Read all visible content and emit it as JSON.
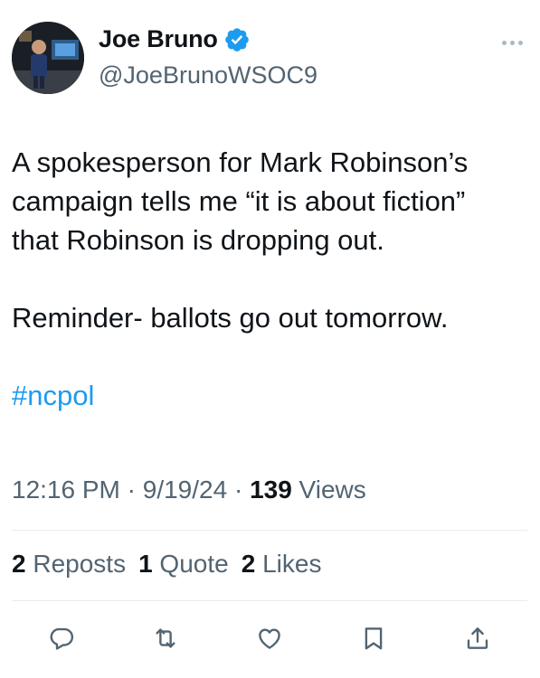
{
  "author": {
    "display_name": "Joe Bruno",
    "handle": "@JoeBrunoWSOC9",
    "verified": true
  },
  "tweet": {
    "lines": [
      "A spokesperson for Mark Robinson’s",
      "campaign tells me “it is about fiction”",
      "that Robinson is dropping out.",
      "Reminder- ballots go out tomorrow."
    ],
    "hashtag": "#ncpol"
  },
  "meta": {
    "time": "12:16 PM",
    "sep1": " · ",
    "date": "9/19/24",
    "sep2": " · ",
    "views_count": "139",
    "views_label": " Views"
  },
  "stats": {
    "reposts_count": "2",
    "reposts_label": " Reposts",
    "quotes_count": "1",
    "quotes_label": " Quote",
    "likes_count": "2",
    "likes_label": " Likes"
  },
  "actions": [
    "reply-icon",
    "repost-icon",
    "like-icon",
    "bookmark-icon",
    "share-icon"
  ],
  "colors": {
    "link": "#1d9bf0",
    "secondary": "#536471",
    "primary": "#0f1419",
    "verified": "#1d9bf0"
  }
}
